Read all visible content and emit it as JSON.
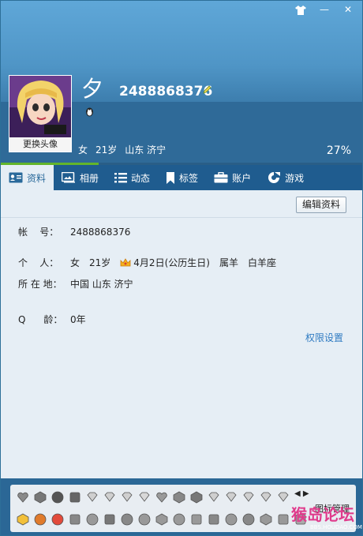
{
  "window": {
    "controls": {
      "skin": "⚒",
      "minimize": "—",
      "close": "✕"
    }
  },
  "profile": {
    "nickname": "夕",
    "qq_number": "2488868376",
    "change_avatar_label": "更换头像",
    "gender": "女",
    "age": "21岁",
    "location": "山东 济宁",
    "completion": "27%",
    "completion_fraction": 0.27
  },
  "tabs": [
    {
      "label": "资料",
      "icon": "profile-card-icon",
      "active": true
    },
    {
      "label": "相册",
      "icon": "album-icon",
      "active": false
    },
    {
      "label": "动态",
      "icon": "feed-icon",
      "active": false
    },
    {
      "label": "标签",
      "icon": "tag-icon",
      "active": false
    },
    {
      "label": "账户",
      "icon": "wallet-icon",
      "active": false
    },
    {
      "label": "游戏",
      "icon": "game-icon",
      "active": false
    }
  ],
  "details": {
    "edit_button": "编辑资料",
    "account_label": "帐    号：",
    "account_value": "2488868376",
    "personal_label": "个    人：",
    "personal_gender": "女",
    "personal_age": "21岁",
    "personal_birthday": "4月2日(公历生日)",
    "personal_zodiac": "属羊",
    "personal_constellation": "白羊座",
    "location_label": "所 在 地：",
    "location_value": "中国 山东 济宁",
    "qage_label": "Q      龄：",
    "qage_value": "0年",
    "permission_link": "权限设置"
  },
  "bottom": {
    "manage_label": "图标管理",
    "nav_arrows": "◀ ▶",
    "watermark": "猴岛论坛",
    "watermark_url": "BBS.HOUDAO.COM"
  },
  "colors": {
    "accent": "#2f7bc2",
    "header": "#3d7eae",
    "tab_bar": "#1f5c8f",
    "progress": "#63b52a"
  }
}
